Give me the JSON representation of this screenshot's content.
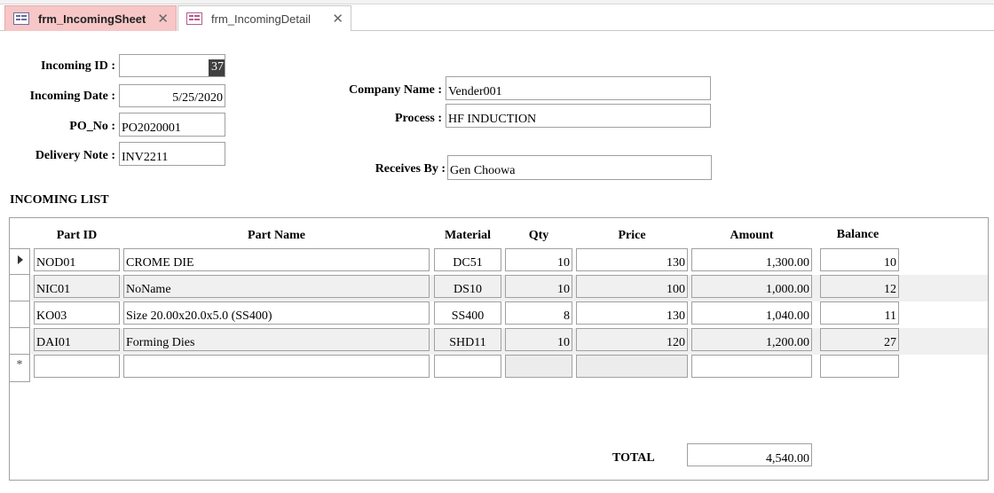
{
  "tabs": [
    {
      "label": "frm_IncomingSheet",
      "icon": "form-icon",
      "close": "✕"
    },
    {
      "label": "frm_IncomingDetail",
      "icon": "form-icon",
      "close": "✕"
    }
  ],
  "header": {
    "incoming_id": {
      "label": "Incoming ID :",
      "value": "37"
    },
    "incoming_date": {
      "label": "Incoming Date :",
      "value": "5/25/2020"
    },
    "po_no": {
      "label": "PO_No :",
      "value": "PO2020001"
    },
    "delivery_note": {
      "label": "Delivery Note :",
      "value": "INV2211"
    },
    "company_name": {
      "label": "Company Name :",
      "value": "Vender001"
    },
    "process": {
      "label": "Process :",
      "value": "HF INDUCTION"
    },
    "receives_by": {
      "label": "Receives By :",
      "value": "Gen Choowa"
    }
  },
  "list": {
    "title": "INCOMING LIST",
    "columns": [
      "Part ID",
      "Part Name",
      "Material",
      "Qty",
      "Price",
      "Amount",
      "Balance"
    ],
    "rows": [
      {
        "part_id": "NOD01",
        "part_name": "CROME DIE",
        "material": "DC51",
        "qty": "10",
        "price": "130",
        "amount": "1,300.00",
        "balance": "10"
      },
      {
        "part_id": "NIC01",
        "part_name": "NoName",
        "material": "DS10",
        "qty": "10",
        "price": "100",
        "amount": "1,000.00",
        "balance": "12"
      },
      {
        "part_id": "KO03",
        "part_name": "Size 20.00x20.0x5.0 (SS400)",
        "material": "SS400",
        "qty": "8",
        "price": "130",
        "amount": "1,040.00",
        "balance": "11"
      },
      {
        "part_id": "DAI01",
        "part_name": "Forming Dies",
        "material": "SHD11",
        "qty": "10",
        "price": "120",
        "amount": "1,200.00",
        "balance": "27"
      }
    ],
    "new_row_marker": "*",
    "total": {
      "label": "TOTAL",
      "value": "4,540.00"
    }
  }
}
